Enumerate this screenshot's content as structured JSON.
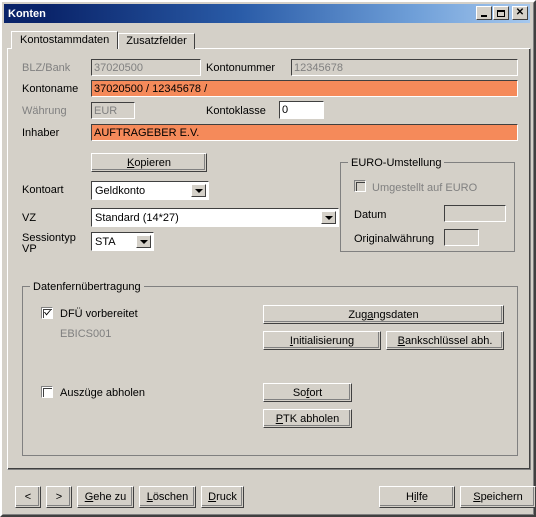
{
  "window": {
    "title": "Konten",
    "controls": {
      "minimize": "minimize",
      "maximize": "maximize",
      "close": "close"
    }
  },
  "tabs": [
    {
      "label": "Kontostammdaten",
      "active": true
    },
    {
      "label": "Zusatzfelder",
      "active": false
    }
  ],
  "form": {
    "blz_label": "BLZ/Bank",
    "blz_value": "37020500",
    "kontonummer_label": "Kontonummer",
    "kontonummer_value": "12345678",
    "kontoname_label": "Kontoname",
    "kontoname_value": "37020500 / 12345678 /",
    "waehrung_label": "Währung",
    "waehrung_value": "EUR",
    "kontoklasse_label": "Kontoklasse",
    "kontoklasse_value": "0",
    "inhaber_label": "Inhaber",
    "inhaber_value": "AUFTRAGEBER  E.V.",
    "kopieren_label": "Kopieren",
    "kopieren_accel": "K",
    "kontoart_label": "Kontoart",
    "kontoart_value": "Geldkonto",
    "vz_label": "VZ",
    "vz_value": "Standard (14*27)",
    "sessiontyp_label_line1": "Sessiontyp",
    "sessiontyp_label_line2": "VP",
    "sessiontyp_value": "STA"
  },
  "euro_group": {
    "title": "EURO-Umstellung",
    "checkbox_label": "Umgestellt auf EURO",
    "checkbox_checked": false,
    "datum_label": "Datum",
    "datum_value": "",
    "originalwaehrung_label": "Originalwährung",
    "originalwaehrung_value": ""
  },
  "dfue_group": {
    "title": "Datenfernübertragung",
    "dfue_checkbox_label": "DFÜ vorbereitet",
    "dfue_checkbox_checked": true,
    "ebics_text": "EBICS001",
    "ausziige_checkbox_label": "Auszüge abholen",
    "ausziige_checkbox_checked": false,
    "zugangsdaten_label": "Zugangsdaten",
    "initialisierung_label": "Initialisierung",
    "bankschluessel_label": "Bankschlüssel abh.",
    "sofort_label": "Sofort",
    "ptk_label": "PTK abholen"
  },
  "bottom": {
    "prev_label": "<",
    "next_label": ">",
    "gehe_zu_label": "Gehe zu",
    "loeschen_label": "Löschen",
    "druck_label": "Druck",
    "hilfe_label": "Hilfe",
    "speichern_label": "Speichern"
  },
  "colors": {
    "face": "#d4d0c8",
    "highlight_orange": "#f58a5a",
    "title_start": "#0a246a",
    "title_end": "#a6c8ee",
    "disabled_text": "#808080"
  }
}
